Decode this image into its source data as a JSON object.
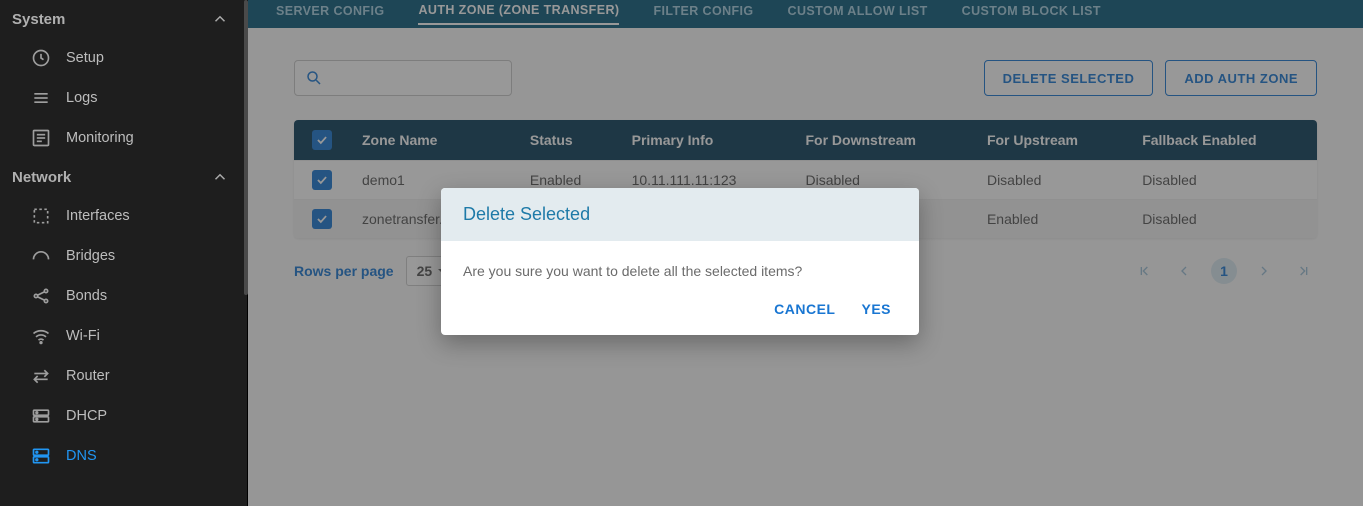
{
  "sidebar": {
    "sections": [
      {
        "title": "System",
        "items": [
          {
            "label": "Setup",
            "icon": "clock"
          },
          {
            "label": "Logs",
            "icon": "lines"
          },
          {
            "label": "Monitoring",
            "icon": "list"
          }
        ]
      },
      {
        "title": "Network",
        "items": [
          {
            "label": "Interfaces",
            "icon": "dashed-box"
          },
          {
            "label": "Bridges",
            "icon": "arc"
          },
          {
            "label": "Bonds",
            "icon": "share"
          },
          {
            "label": "Wi-Fi",
            "icon": "wifi"
          },
          {
            "label": "Router",
            "icon": "arrows-lr"
          },
          {
            "label": "DHCP",
            "icon": "server"
          },
          {
            "label": "DNS",
            "icon": "server2",
            "active": true
          }
        ]
      }
    ]
  },
  "tabs": [
    {
      "label": "SERVER CONFIG"
    },
    {
      "label": "AUTH ZONE (ZONE TRANSFER)",
      "active": true
    },
    {
      "label": "FILTER CONFIG"
    },
    {
      "label": "CUSTOM ALLOW LIST"
    },
    {
      "label": "CUSTOM BLOCK LIST"
    }
  ],
  "toolbar": {
    "search_placeholder": "",
    "delete_selected": "DELETE SELECTED",
    "add_auth_zone": "ADD AUTH ZONE"
  },
  "table": {
    "headers": [
      "Zone Name",
      "Status",
      "Primary Info",
      "For Downstream",
      "For Upstream",
      "Fallback Enabled"
    ],
    "rows": [
      {
        "checked": true,
        "cells": [
          "demo1",
          "Enabled",
          "10.11.111.11:123",
          "Disabled",
          "Disabled",
          "Disabled"
        ]
      },
      {
        "checked": true,
        "cells": [
          "zonetransfer.me",
          "",
          "",
          "",
          "Enabled",
          "Disabled"
        ]
      }
    ]
  },
  "pager": {
    "rows_per_page_label": "Rows per page",
    "rows_per_page_value": "25",
    "current_page": "1"
  },
  "dialog": {
    "title": "Delete Selected",
    "message": "Are you sure you want to delete all the selected items?",
    "cancel": "CANCEL",
    "yes": "YES"
  }
}
